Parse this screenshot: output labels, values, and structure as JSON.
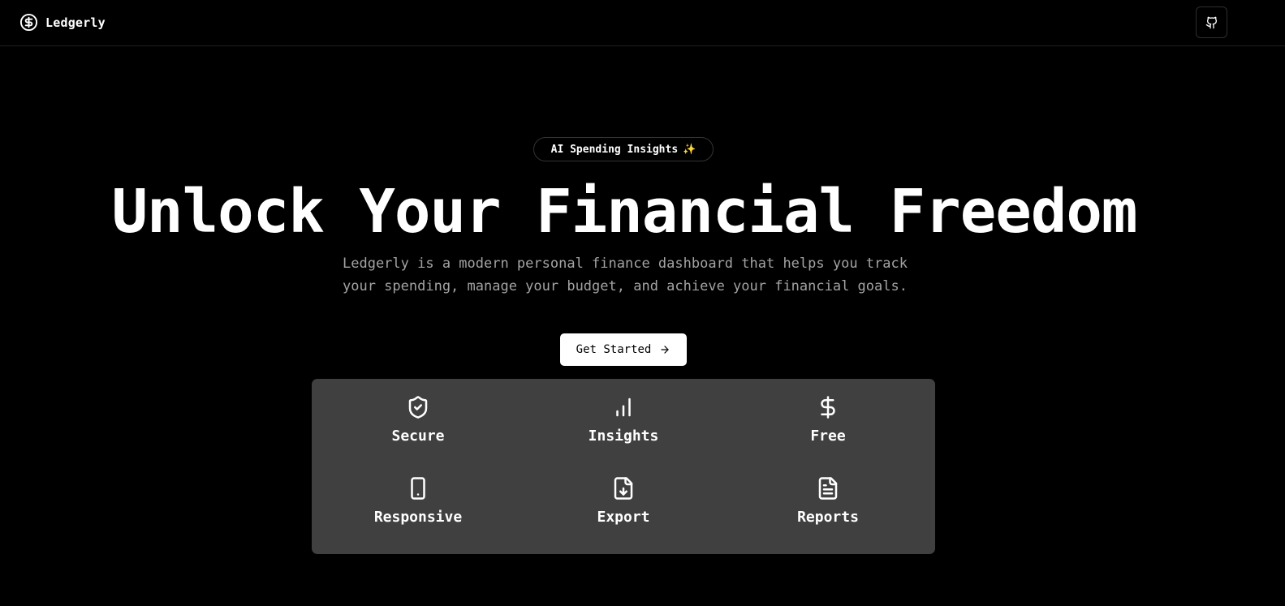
{
  "header": {
    "brand_name": "Ledgerly",
    "brand_icon": "dollar-circle-icon",
    "github_icon": "github-icon"
  },
  "hero": {
    "badge_text": "AI Spending Insights",
    "badge_emoji": "✨",
    "headline": "Unlock Your Financial Freedom",
    "subtitle": "Ledgerly is a modern personal finance dashboard that helps you track your spending, manage your budget, and achieve your financial goals.",
    "cta_label": "Get Started",
    "cta_icon": "arrow-right-icon"
  },
  "features": [
    {
      "label": "Secure",
      "icon": "shield-check-icon"
    },
    {
      "label": "Insights",
      "icon": "bar-chart-icon"
    },
    {
      "label": "Free",
      "icon": "dollar-sign-icon"
    },
    {
      "label": "Responsive",
      "icon": "smartphone-icon"
    },
    {
      "label": "Export",
      "icon": "file-download-icon"
    },
    {
      "label": "Reports",
      "icon": "file-text-icon"
    }
  ],
  "colors": {
    "background": "#000000",
    "text": "#ffffff",
    "muted_text": "#a3a3a3",
    "panel": "#404040",
    "sparkle": "#f5c542"
  }
}
